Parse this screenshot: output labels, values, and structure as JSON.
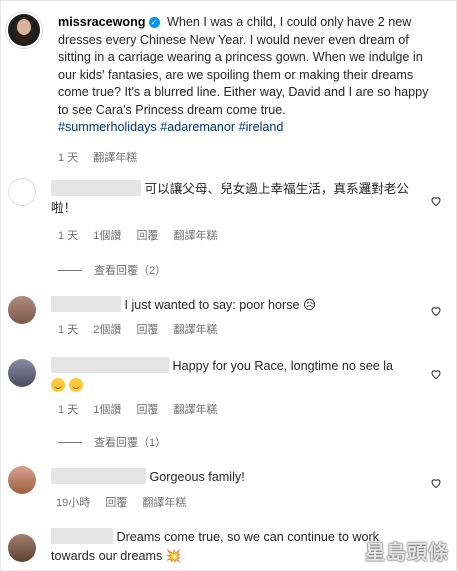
{
  "post": {
    "username": "missracewong",
    "caption": "When I was a child, I could only have 2 new dresses every Chinese New Year. I would never even dream of sitting in a carriage wearing a princess gown. When we indulge in our kids' fantasies, are we spoiling them or making their dreams come true? It's a blurred line. Either way, David and I are so happy to see Cara's Princess dream come true.",
    "hashtags": [
      "#summerholidays",
      "#adaremanor",
      "#ireland"
    ],
    "time": "1 天",
    "translate": "翻譯年糕"
  },
  "comments": [
    {
      "text": "可以讓父母、兒女過上幸福生活，真系邏對老公啦！",
      "time": "1 天",
      "likes": "1個讚",
      "reply": "回覆",
      "translate": "翻譯年糕",
      "view_replies": "查看回覆（2）"
    },
    {
      "text": "I just wanted to say: poor horse 😥",
      "time": "1 天",
      "likes": "2個讚",
      "reply": "回覆",
      "translate": "翻譯年糕"
    },
    {
      "text": "Happy for you Race, longtime no see la",
      "time": "1 天",
      "likes": "1個讚",
      "reply": "回覆",
      "translate": "翻譯年糕",
      "view_replies": "查看回覆（1）"
    },
    {
      "text": "Gorgeous family!",
      "time": "19小時",
      "reply": "回覆",
      "translate": "翻譯年糕"
    },
    {
      "text": "Dreams come true, so we can continue to work towards our dreams 💥"
    }
  ],
  "watermark": "星島頭條",
  "colors": {
    "hashtag": "#00376b",
    "verified": "#0095f6",
    "meta": "#737373"
  }
}
